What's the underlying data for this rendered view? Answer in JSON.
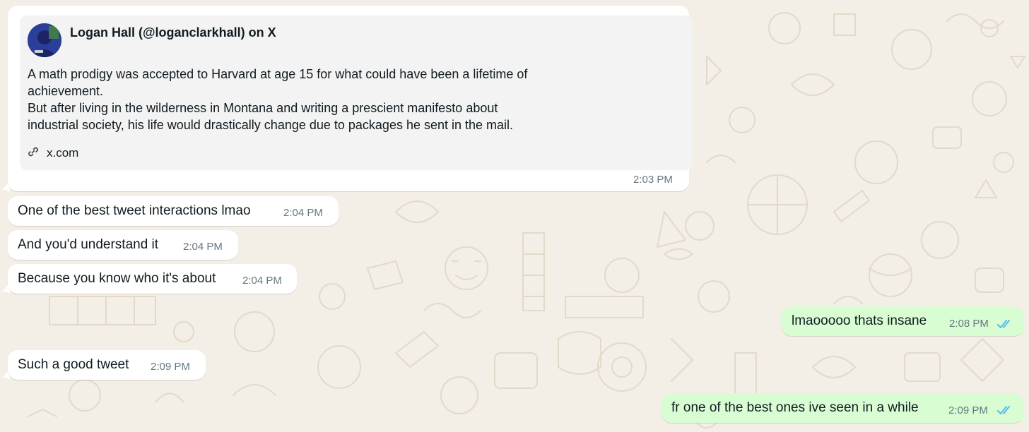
{
  "link_preview": {
    "title": "Logan Hall (@loganclarkhall) on X",
    "description_lines": [
      "A math prodigy was accepted to Harvard at age 15 for what could have been a lifetime of",
      "achievement.",
      "But after living in the wilderness in Montana and writing a prescient manifesto about",
      "industrial society, his life would drastically change due to packages he sent in the mail."
    ],
    "domain": "x.com",
    "time": "2:03 PM"
  },
  "messages": [
    {
      "direction": "in",
      "text": "One of the best tweet interactions lmao",
      "time": "2:04 PM"
    },
    {
      "direction": "in",
      "text": "And you'd understand it",
      "time": "2:04 PM"
    },
    {
      "direction": "in",
      "text": "Because you know who it's about",
      "time": "2:04 PM"
    },
    {
      "direction": "out",
      "text": "lmaooooo thats insane",
      "time": "2:08 PM",
      "status": "read"
    },
    {
      "direction": "in",
      "text": "Such a good tweet",
      "time": "2:09 PM"
    },
    {
      "direction": "out",
      "text": "fr one of the best ones ive seen in a while",
      "time": "2:09 PM",
      "status": "read"
    }
  ],
  "colors": {
    "wallpaper": "#f3eee6",
    "incoming_bubble": "#ffffff",
    "outgoing_bubble": "#d9fdd3",
    "read_ticks": "#53bdeb",
    "timestamp": "#667781"
  },
  "icons": {
    "link": "link-icon",
    "read_receipt": "double-check-icon"
  }
}
